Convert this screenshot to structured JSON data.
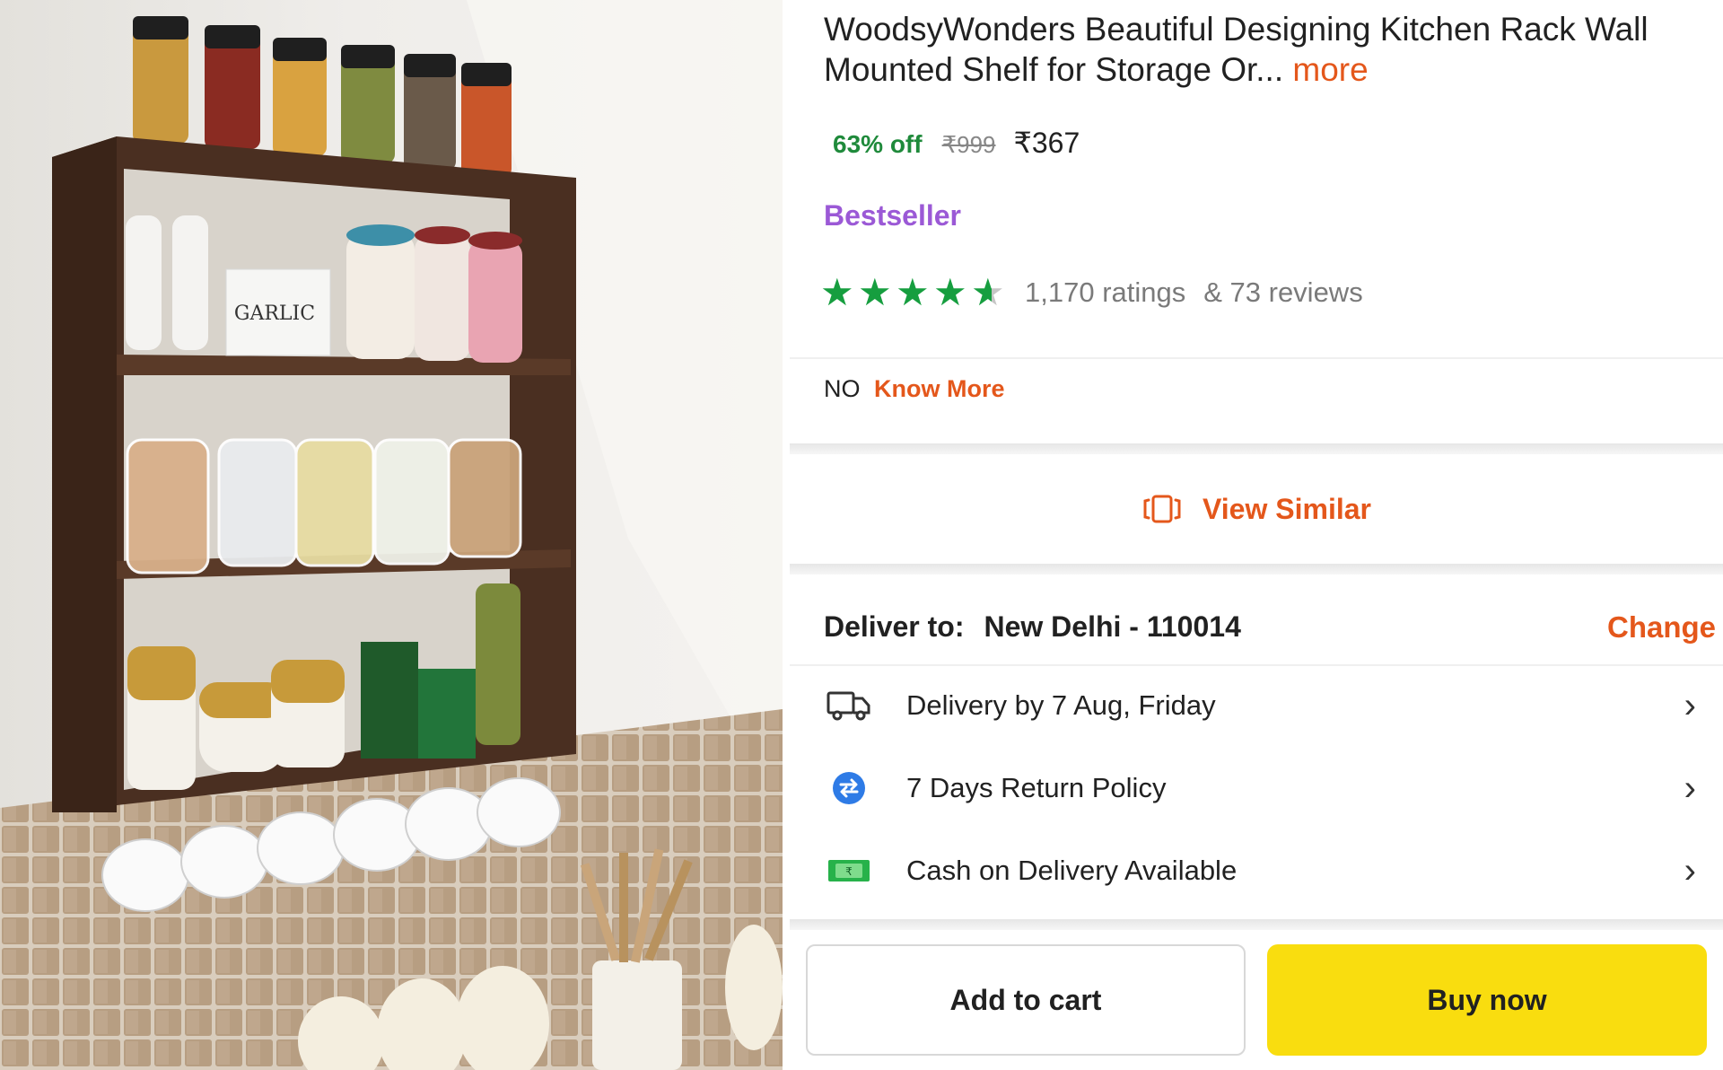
{
  "product": {
    "title": "WoodsyWonders Beautiful Designing Kitchen Rack Wall Mounted Shelf for Storage Or...",
    "more_label": "more",
    "discount": "63% off",
    "mrp": "₹999",
    "price": "₹367",
    "badge": "Bestseller",
    "rating_value": 4.5,
    "ratings_text": "1,170 ratings",
    "reviews_text": "& 73 reviews"
  },
  "photo": {
    "jar_labels": [
      "GARLIC"
    ]
  },
  "know_more": {
    "prefix": "NO",
    "link": "Know More"
  },
  "view_similar": {
    "label": "View Similar",
    "icon": "view-similar-icon"
  },
  "delivery": {
    "label": "Deliver to:",
    "location": "New Delhi - 110014",
    "change_label": "Change",
    "rows": [
      {
        "icon": "truck-icon",
        "text": "Delivery by 7 Aug, Friday"
      },
      {
        "icon": "return-icon",
        "text": "7 Days Return Policy"
      },
      {
        "icon": "cash-icon",
        "text": "Cash on Delivery Available"
      }
    ]
  },
  "actions": {
    "add_to_cart": "Add to cart",
    "buy_now": "Buy now"
  },
  "colors": {
    "accent": "#e4571b",
    "discount": "#1f8a3b",
    "badge": "#9b59d6",
    "star": "#169e3f",
    "buy_button": "#f9dd0f"
  }
}
